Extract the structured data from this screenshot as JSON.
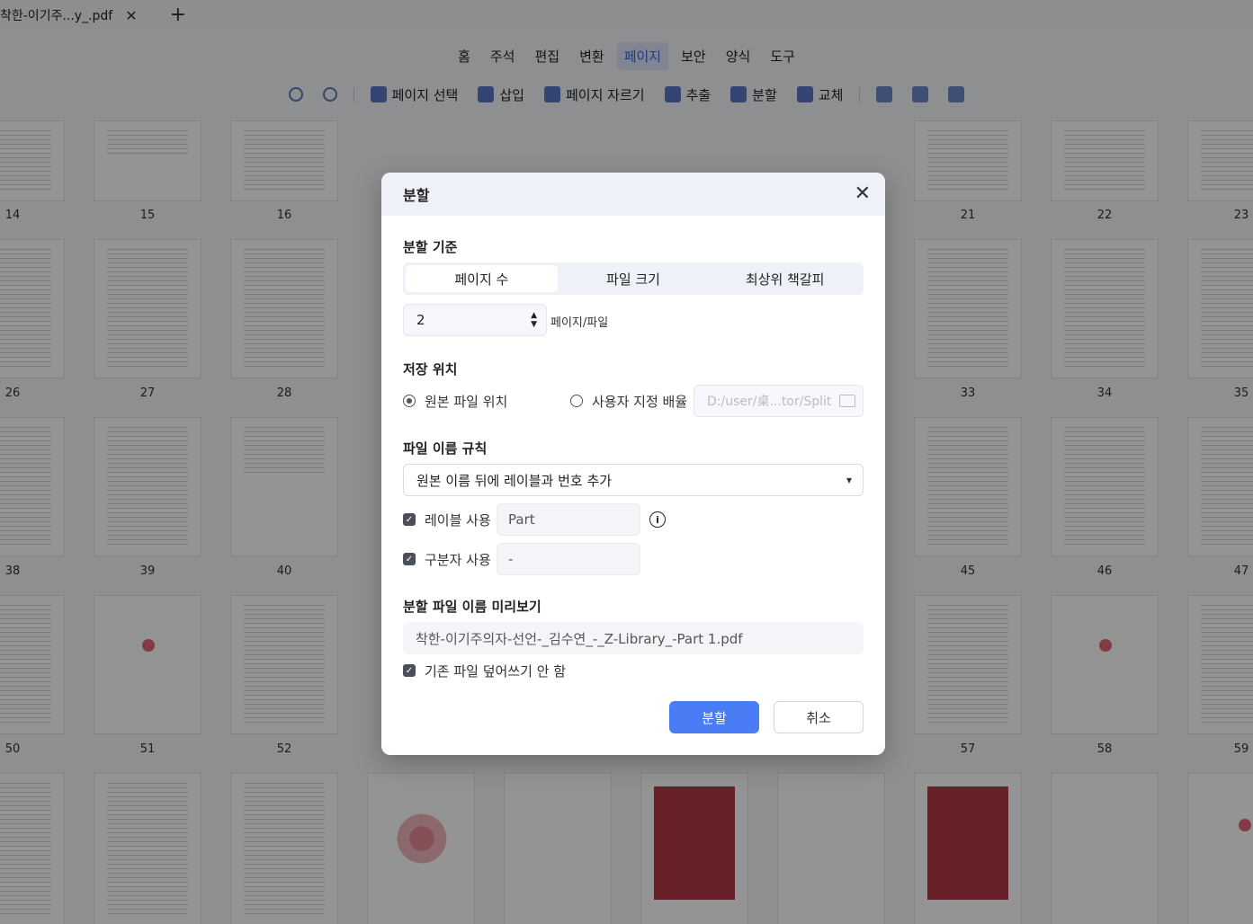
{
  "tab": {
    "title": "착한-이기주...y_.pdf",
    "close": "✕",
    "add": "+"
  },
  "menu": [
    {
      "label": "홈"
    },
    {
      "label": "주석"
    },
    {
      "label": "편집"
    },
    {
      "label": "변환"
    },
    {
      "label": "페이지",
      "active": true
    },
    {
      "label": "보안"
    },
    {
      "label": "양식"
    },
    {
      "label": "도구"
    }
  ],
  "toolbar": {
    "page_select": "페이지 선택",
    "insert": "삽입",
    "crop": "페이지 자르기",
    "extract": "추출",
    "split": "분할",
    "replace": "교체"
  },
  "page_numbers": [
    [
      "14",
      "15",
      "16",
      "21",
      "22",
      "23"
    ],
    [
      "26",
      "27",
      "28",
      "33",
      "34",
      "35"
    ],
    [
      "38",
      "39",
      "40",
      "45",
      "46",
      "47"
    ],
    [
      "50",
      "51",
      "52",
      "57",
      "58",
      "59"
    ]
  ],
  "dialog": {
    "title": "분할",
    "close": "✕",
    "criteria_title": "분할 기준",
    "criteria_options": [
      "페이지 수",
      "파일 크기",
      "최상위 책갈피"
    ],
    "criteria_selected": 0,
    "pages_value": "2",
    "pages_unit": "페이지/파일",
    "location_title": "저장 위치",
    "location_original": "원본 파일 위치",
    "location_custom": "사용자 지정 배율",
    "location_path": "D:/user/桌...tor/Split",
    "naming_title": "파일 이름 규칙",
    "naming_rule": "원본 이름 뒤에 레이블과 번호 추가",
    "use_label": "레이블 사용",
    "label_value": "Part",
    "use_separator": "구분자 사용",
    "separator_value": "-",
    "preview_title": "분할 파일 이름 미리보기",
    "preview_value": "착한-이기주의자-선언-_김수연_-_Z-Library_-Part 1.pdf",
    "no_overwrite": "기존 파일 덮어쓰기 안 함",
    "split_button": "분할",
    "cancel_button": "취소"
  },
  "colors": {
    "accent": "#4a7cf6",
    "menu_active": "#3a63d8"
  }
}
